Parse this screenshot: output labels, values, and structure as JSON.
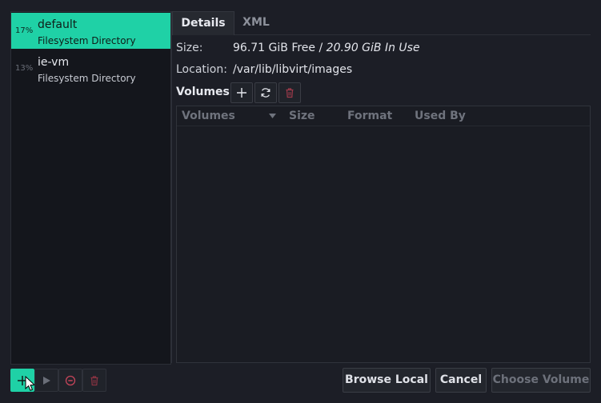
{
  "pools": [
    {
      "percent": "17%",
      "name": "default",
      "type": "Filesystem Directory",
      "selected": true
    },
    {
      "percent": "13%",
      "name": "ie-vm",
      "type": "Filesystem Directory",
      "selected": false
    }
  ],
  "tabs": {
    "details": "Details",
    "xml": "XML"
  },
  "details": {
    "size_label": "Size:",
    "size_free": "96.71 GiB Free / ",
    "size_in_use": "20.90 GiB In Use",
    "location_label": "Location:",
    "location_value": "/var/lib/libvirt/images"
  },
  "volumes": {
    "label": "Volumes",
    "columns": {
      "name": "Volumes",
      "size": "Size",
      "format": "Format",
      "used_by": "Used By"
    },
    "rows": []
  },
  "buttons": {
    "browse_local": "Browse Local",
    "cancel": "Cancel",
    "choose_volume": "Choose Volume"
  },
  "icons": {
    "add_volume": "plus-icon",
    "refresh": "refresh-icon",
    "delete_volume": "trash-icon",
    "add_pool": "plus-icon",
    "start_pool": "play-icon",
    "stop_pool": "stop-icon",
    "delete_pool": "trash-icon"
  },
  "colors": {
    "accent": "#1fd1a6",
    "danger": "#c4455a",
    "background": "#1c1e26"
  }
}
